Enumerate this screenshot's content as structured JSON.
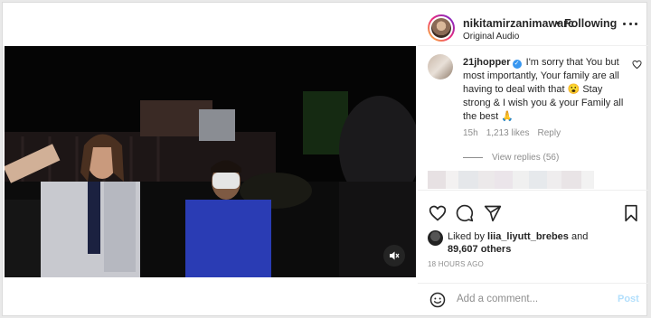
{
  "header": {
    "username": "nikitamirzanimawarc",
    "separator": "•",
    "following_label": "Following",
    "audio_label": "Original Audio",
    "more_icon": "more-horizontal-icon"
  },
  "comment": {
    "username": "21jhopper",
    "text": "I'm sorry that You but most importantly, Your family are all having to deal with that 😮 Stay strong & I wish you & your Family all the best 🙏",
    "time": "15h",
    "likes": "1,213 likes",
    "reply_label": "Reply",
    "view_replies": "View replies (56)"
  },
  "actions": {
    "like_icon": "heart-icon",
    "comment_icon": "comment-icon",
    "share_icon": "send-icon",
    "save_icon": "bookmark-icon"
  },
  "likes": {
    "liked_by_prefix": "Liked by ",
    "liked_by_user": "liia_liyutt_brebes",
    "and_label": " and ",
    "others": "89,607 others"
  },
  "timeago": "18 HOURS AGO",
  "comment_bar": {
    "placeholder": "Add a comment...",
    "post_label": "Post"
  },
  "colors": {
    "accent_blue": "#3897f0",
    "post_disabled": "#b2dffc",
    "muted_text": "#8e8e8e"
  }
}
